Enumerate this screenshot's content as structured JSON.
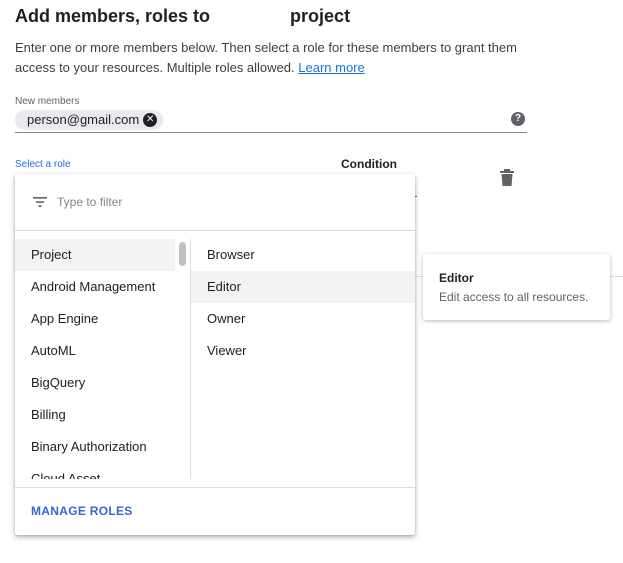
{
  "header": {
    "title_prefix": "Add members, roles to",
    "title_suffix": "project",
    "description": "Enter one or more members below. Then select a role for these members to grant them access to your resources. Multiple roles allowed.",
    "learn_more": "Learn more"
  },
  "members": {
    "label": "New members",
    "chip": "person@gmail.com"
  },
  "role": {
    "label": "Select a role",
    "condition_label": "Condition"
  },
  "dropdown": {
    "filter_placeholder": "Type to filter",
    "categories": [
      "Project",
      "Android Management",
      "App Engine",
      "AutoML",
      "BigQuery",
      "Billing",
      "Binary Authorization",
      "Cloud Asset"
    ],
    "roles": [
      "Browser",
      "Editor",
      "Owner",
      "Viewer"
    ],
    "manage_roles": "MANAGE ROLES"
  },
  "tooltip": {
    "title": "Editor",
    "description": "Edit access to all resources."
  },
  "colors": {
    "accent": "#1a73e8",
    "manage_roles": "#3367d6",
    "hover": "#f1f3f4"
  }
}
